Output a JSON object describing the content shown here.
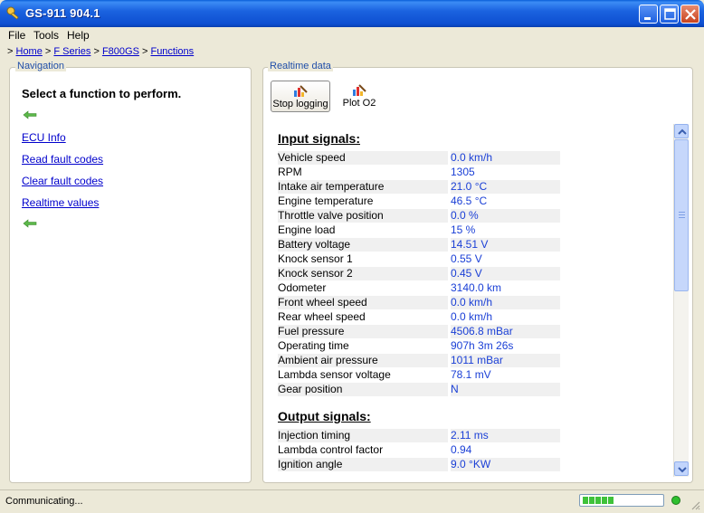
{
  "window": {
    "title": "GS-911 904.1"
  },
  "menu": {
    "file": "File",
    "tools": "Tools",
    "help": "Help"
  },
  "breadcrumb": {
    "prefix": ">",
    "sep": ">",
    "items": [
      "Home",
      "F Series",
      "F800GS",
      "Functions"
    ]
  },
  "navigation": {
    "group_label": "Navigation",
    "heading": "Select a function to perform.",
    "links": [
      "ECU Info",
      "Read fault codes",
      "Clear fault codes",
      "Realtime values"
    ]
  },
  "realtime": {
    "group_label": "Realtime data",
    "stop_button": "Stop logging",
    "plot_button": "Plot O2",
    "input_title": "Input signals:",
    "output_title": "Output signals:",
    "inputs": [
      {
        "name": "Vehicle speed",
        "value": "0.0 km/h"
      },
      {
        "name": "RPM",
        "value": "1305"
      },
      {
        "name": "Intake air temperature",
        "value": "21.0 °C"
      },
      {
        "name": "Engine temperature",
        "value": "46.5 °C"
      },
      {
        "name": "Throttle valve position",
        "value": "0.0 %"
      },
      {
        "name": "Engine load",
        "value": "15 %"
      },
      {
        "name": "Battery voltage",
        "value": "14.51 V"
      },
      {
        "name": "Knock sensor 1",
        "value": "0.55 V"
      },
      {
        "name": "Knock sensor 2",
        "value": "0.45 V"
      },
      {
        "name": "Odometer",
        "value": "3140.0 km"
      },
      {
        "name": "Front wheel speed",
        "value": "0.0 km/h"
      },
      {
        "name": "Rear wheel speed",
        "value": "0.0 km/h"
      },
      {
        "name": "Fuel pressure",
        "value": "4506.8 mBar"
      },
      {
        "name": "Operating time",
        "value": "907h 3m 26s"
      },
      {
        "name": "Ambient air pressure",
        "value": "1011 mBar"
      },
      {
        "name": "Lambda sensor voltage",
        "value": "78.1 mV"
      },
      {
        "name": "Gear position",
        "value": "N"
      }
    ],
    "outputs": [
      {
        "name": "Injection timing",
        "value": "2.11 ms"
      },
      {
        "name": "Lambda control factor",
        "value": "0.94"
      },
      {
        "name": "Ignition angle",
        "value": "9.0 °KW"
      }
    ]
  },
  "status": {
    "text": "Communicating...",
    "progress_segments_filled": 5,
    "connection_led": "green",
    "accent_color": "#1a3fd6"
  }
}
